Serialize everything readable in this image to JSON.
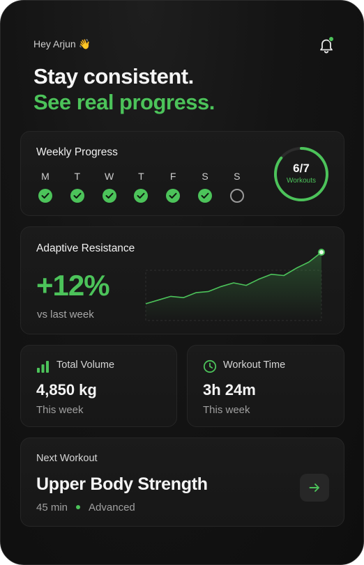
{
  "header": {
    "greeting": "Hey Arjun 👋",
    "headline_line1": "Stay consistent.",
    "headline_line2": "See real progress."
  },
  "weekly_progress": {
    "title": "Weekly Progress",
    "days": [
      {
        "letter": "M",
        "done": true
      },
      {
        "letter": "T",
        "done": true
      },
      {
        "letter": "W",
        "done": true
      },
      {
        "letter": "T",
        "done": true
      },
      {
        "letter": "F",
        "done": true
      },
      {
        "letter": "S",
        "done": true
      },
      {
        "letter": "S",
        "done": false
      }
    ],
    "completed": 6,
    "total": 7,
    "ring_value": "6/7",
    "ring_label": "Workouts"
  },
  "adaptive_resistance": {
    "title": "Adaptive Resistance",
    "change": "+12%",
    "comparison": "vs last week",
    "trend": [
      10,
      13,
      16,
      15,
      19,
      20,
      24,
      27,
      25,
      30,
      34,
      33,
      39,
      44,
      52
    ]
  },
  "stats": {
    "volume": {
      "label": "Total Volume",
      "value": "4,850 kg",
      "sub": "This week",
      "icon": "bar-chart-icon"
    },
    "time": {
      "label": "Workout Time",
      "value": "3h 24m",
      "sub": "This week",
      "icon": "clock-icon"
    }
  },
  "next_workout": {
    "label": "Next Workout",
    "name": "Upper Body Strength",
    "duration": "45 min",
    "level": "Advanced"
  },
  "colors": {
    "accent": "#4cc35a",
    "background": "#141414",
    "card": "#1a1a1a"
  }
}
